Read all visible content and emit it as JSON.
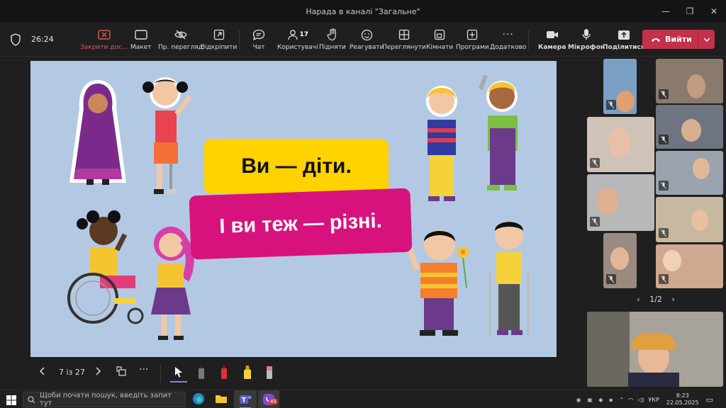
{
  "window": {
    "title": "Нарада в каналі \"Загальне\""
  },
  "toolbar": {
    "timer": "26:24",
    "items": [
      {
        "label": "Закрити дос..."
      },
      {
        "label": "Макет"
      },
      {
        "label": "Пр. перегляд"
      },
      {
        "label": "Відкріпити"
      },
      {
        "label": "Чат"
      },
      {
        "label": "Користувачі",
        "count": "17"
      },
      {
        "label": "Підняти"
      },
      {
        "label": "Реагувати"
      },
      {
        "label": "Переглянути"
      },
      {
        "label": "Кімнати"
      },
      {
        "label": "Програми"
      },
      {
        "label": "Додатково"
      },
      {
        "label": "Камера"
      },
      {
        "label": "Мікрофон"
      },
      {
        "label": "Поділитися"
      }
    ],
    "leave_label": "Вийти"
  },
  "slide": {
    "line1": "Ви — діти.",
    "line2": "І ви теж — різні."
  },
  "slide_nav": {
    "page": "7 із 27"
  },
  "gallery": {
    "page": "1/2"
  },
  "taskbar": {
    "search_placeholder": "Щоби почати пошук, введіть запит тут",
    "lang": "УКР",
    "time": "8:23",
    "date": "22.05.2025",
    "viber_badge": "45"
  },
  "colors": {
    "accent_red": "#c4314b",
    "slide_bg": "#b3c9e3",
    "yellow": "#ffd200",
    "pink": "#d8127d"
  }
}
